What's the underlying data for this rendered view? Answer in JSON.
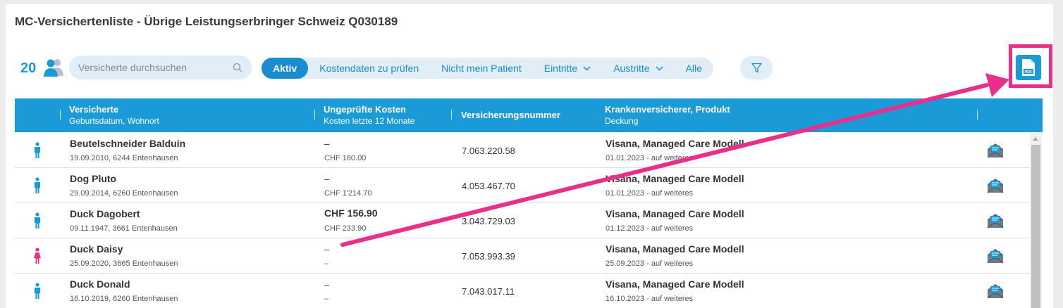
{
  "page": {
    "title": "MC-Versichertenliste - Übrige Leistungserbringer Schweiz Q030189"
  },
  "toolbar": {
    "count": "20",
    "search_placeholder": "Versicherte durchsuchen",
    "filters": [
      {
        "label": "Aktiv",
        "active": true,
        "dropdown": false
      },
      {
        "label": "Kostendaten zu prüfen",
        "active": false,
        "dropdown": false
      },
      {
        "label": "Nicht mein Patient",
        "active": false,
        "dropdown": false
      },
      {
        "label": "Eintritte",
        "active": false,
        "dropdown": true
      },
      {
        "label": "Austritte",
        "active": false,
        "dropdown": true
      },
      {
        "label": "Alle",
        "active": false,
        "dropdown": false
      }
    ]
  },
  "table": {
    "headers": {
      "insured_title": "Versicherte",
      "insured_sub": "Geburtsdatum, Wohnort",
      "costs_title": "Ungeprüfte Kosten",
      "costs_sub": "Kosten letzte 12 Monate",
      "number_title": "Versicherungsnummer",
      "insurer_title": "Krankenversicherer, Produkt",
      "insurer_sub": "Deckung"
    },
    "rows": [
      {
        "gender": "male",
        "name": "Beutelschneider Balduin",
        "details": "19.09.2010, 6244 Entenhausen",
        "unchecked": "–",
        "unchecked_bold": false,
        "costs12": "CHF 180.00",
        "number": "7.063.220.58",
        "insurer": "Visana, Managed Care Modell",
        "coverage": "01.01.2023 - auf weiteres"
      },
      {
        "gender": "male",
        "name": "Dog Pluto",
        "details": "29.09.2014, 6260 Entenhausen",
        "unchecked": "–",
        "unchecked_bold": false,
        "costs12": "CHF 1'214.70",
        "number": "4.053.467.70",
        "insurer": "Visana, Managed Care Modell",
        "coverage": "01.01.2023 - auf weiteres"
      },
      {
        "gender": "male",
        "name": "Duck Dagobert",
        "details": "09.11.1947, 3661 Entenhausen",
        "unchecked": "CHF 156.90",
        "unchecked_bold": true,
        "costs12": "CHF 233.90",
        "number": "3.043.729.03",
        "insurer": "Visana, Managed Care Modell",
        "coverage": "01.12.2023 - auf weiteres"
      },
      {
        "gender": "female",
        "name": "Duck Daisy",
        "details": "25.09.2020, 3665 Entenhausen",
        "unchecked": "–",
        "unchecked_bold": false,
        "costs12": "–",
        "number": "7.053.993.39",
        "insurer": "Visana, Managed Care Modell",
        "coverage": "25.09.2023 - auf weiteres"
      },
      {
        "gender": "male",
        "name": "Duck Donald",
        "details": "16.10.2019, 6260 Entenhausen",
        "unchecked": "–",
        "unchecked_bold": false,
        "costs12": "–",
        "number": "7.043.017.11",
        "insurer": "Visana, Managed Care Modell",
        "coverage": "16.10.2023 - auf weiteres"
      }
    ]
  },
  "colors": {
    "accent": "#1a9ad6",
    "highlight": "#e8308a",
    "female": "#e8308a",
    "male": "#1a9ad6"
  },
  "icons": {
    "users": "users-icon",
    "search": "search-icon",
    "filter": "filter-icon",
    "pdf": "pdf-icon",
    "mail": "mail-icon"
  }
}
